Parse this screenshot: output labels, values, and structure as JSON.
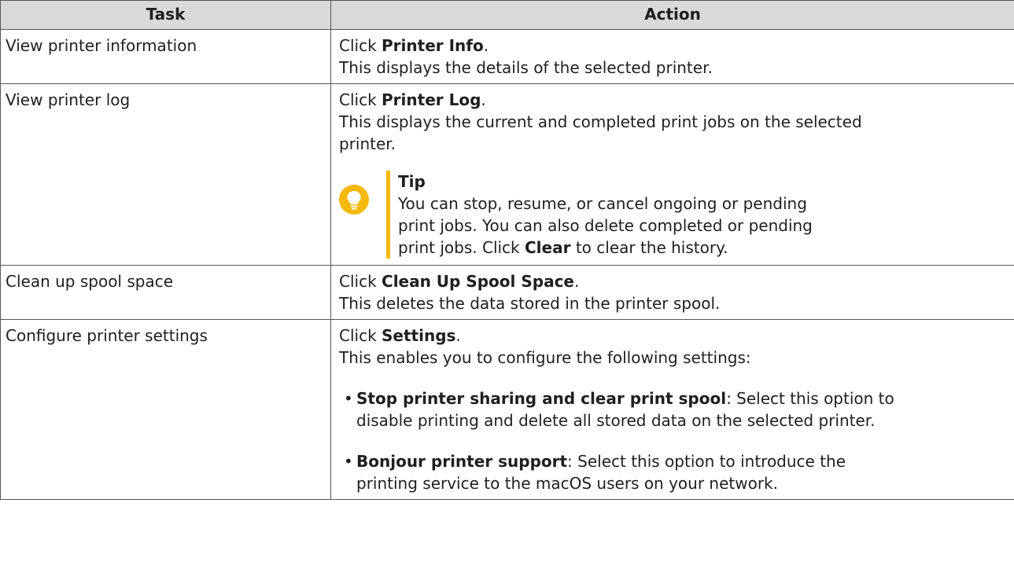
{
  "headers": {
    "task": "Task",
    "action": "Action"
  },
  "rows": [
    {
      "task": "View printer information",
      "prefix": "Click ",
      "bold": "Printer Info",
      "suffix": ".",
      "description": "This displays the details of the selected printer."
    },
    {
      "task": "View printer log",
      "prefix": "Click ",
      "bold": "Printer Log",
      "suffix": ".",
      "description_line1": "This displays the current and completed print jobs on the selected",
      "description_line2": "printer.",
      "tip": {
        "title": "Tip",
        "line1": "You can stop, resume, or cancel ongoing or pending",
        "line2": "print jobs. You can also delete completed or pending",
        "line3_prefix": "print jobs. Click ",
        "line3_bold": "Clear",
        "line3_suffix": " to clear the history."
      }
    },
    {
      "task": "Clean up spool space",
      "prefix": "Click ",
      "bold": "Clean Up Spool Space",
      "suffix": ".",
      "description": "This deletes the data stored in the printer spool."
    },
    {
      "task": "Configure printer settings",
      "prefix": "Click ",
      "bold": "Settings",
      "suffix": ".",
      "description": "This enables you to configure the following settings:",
      "settings": [
        {
          "bullet": "•",
          "bold": "Stop printer sharing and clear print spool",
          "line1": ": Select this option to",
          "line2": "disable printing and delete all stored data on the selected printer."
        },
        {
          "bullet": "•",
          "bold": "Bonjour printer support",
          "line1": ": Select this option to introduce the",
          "line2": "printing service to the macOS users on your network."
        }
      ]
    }
  ],
  "colors": {
    "header_bg": "#d9d9d9",
    "border": "#555555",
    "tip_accent": "#f5b80c"
  },
  "icons": {
    "tip": "lightbulb-icon"
  }
}
